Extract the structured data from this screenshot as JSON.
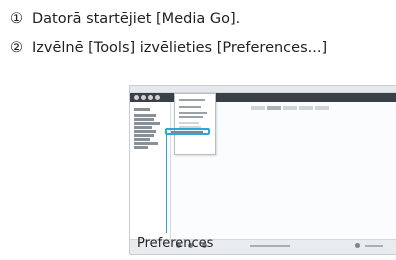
{
  "steps": [
    {
      "number": "①",
      "text": "Datorā startējiet [Media Go]."
    },
    {
      "number": "②",
      "text": "Izvēlnē [Tools] izvēlieties [Preferences...]"
    }
  ],
  "callout": {
    "label": "Preferences"
  },
  "colors": {
    "highlight": "#2aa8d8",
    "text": "#222222"
  }
}
